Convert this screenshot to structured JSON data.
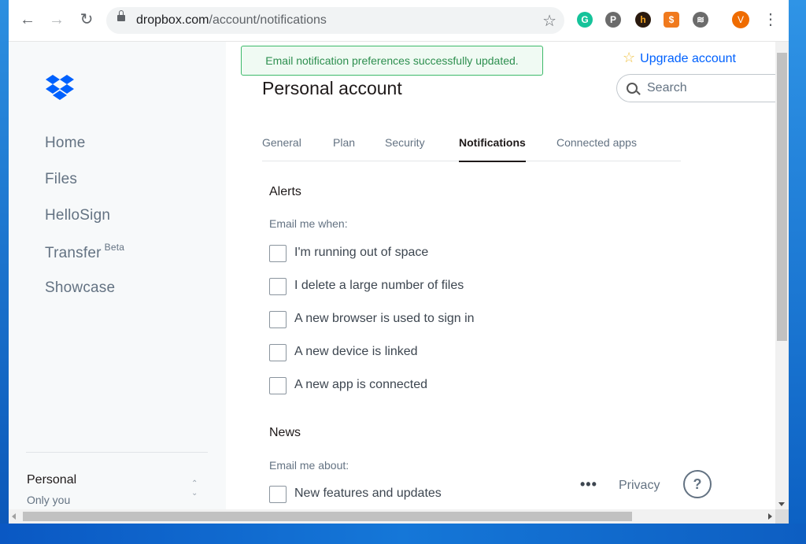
{
  "browser": {
    "url_host": "dropbox.com",
    "url_path": "/account/notifications",
    "profile_initial": "V",
    "extensions": [
      "grammarly-icon",
      "pinterest-icon",
      "honey-icon",
      "price-tag-icon",
      "spotify-icon"
    ]
  },
  "sidebar": {
    "items": [
      {
        "label": "Home"
      },
      {
        "label": "Files"
      },
      {
        "label": "HelloSign"
      },
      {
        "label": "Transfer",
        "badge": "Beta"
      },
      {
        "label": "Showcase"
      }
    ],
    "account": {
      "name": "Personal",
      "sub": "Only you"
    }
  },
  "toast": {
    "message": "Email notification preferences successfully updated."
  },
  "header": {
    "upgrade_label": "Upgrade account",
    "search_placeholder": "Search",
    "title": "Personal account"
  },
  "tabs": [
    {
      "label": "General"
    },
    {
      "label": "Plan"
    },
    {
      "label": "Security"
    },
    {
      "label": "Notifications",
      "active": true
    },
    {
      "label": "Connected apps"
    }
  ],
  "alerts": {
    "heading": "Alerts",
    "subheading": "Email me when:",
    "options": [
      {
        "label": "I'm running out of space",
        "checked": false
      },
      {
        "label": "I delete a large number of files",
        "checked": false
      },
      {
        "label": "A new browser is used to sign in",
        "checked": false
      },
      {
        "label": "A new device is linked",
        "checked": false
      },
      {
        "label": "A new app is connected",
        "checked": false
      }
    ]
  },
  "news": {
    "heading": "News",
    "subheading": "Email me about:",
    "options": [
      {
        "label": "New features and updates",
        "checked": false
      }
    ]
  },
  "footer": {
    "more": "•••",
    "privacy": "Privacy",
    "help": "?"
  },
  "colors": {
    "brand": "#0061fe",
    "success": "#3dba6a"
  }
}
